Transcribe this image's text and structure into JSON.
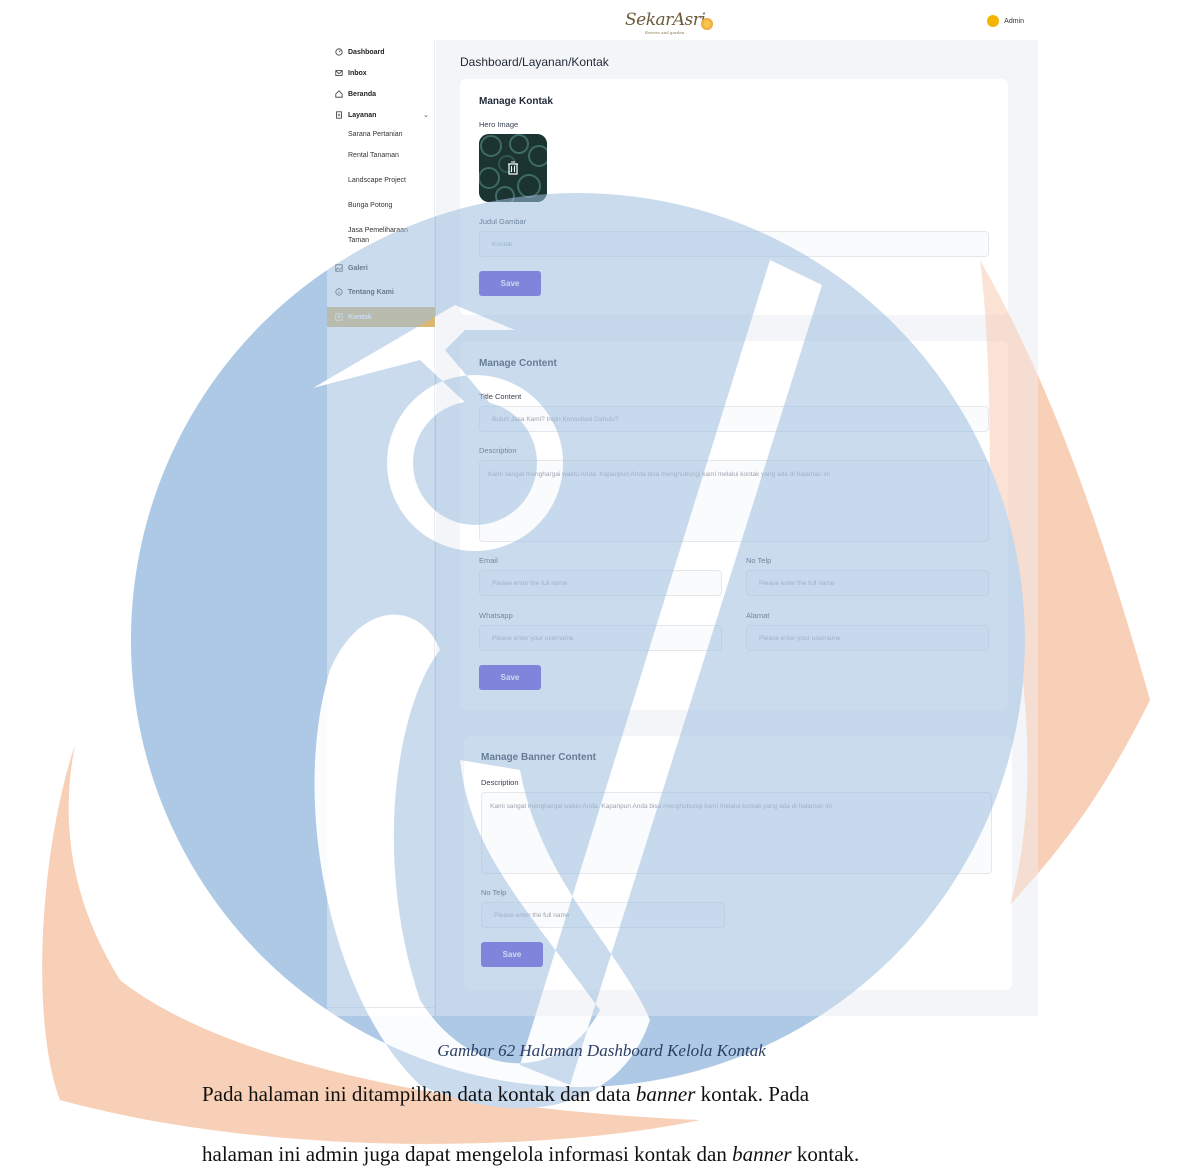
{
  "header": {
    "logo_text": "SekarAsri",
    "logo_tagline": "flowers and garden",
    "user_name": "Admin"
  },
  "sidebar": {
    "items": [
      {
        "label": "Dashboard",
        "icon": "dashboard-icon"
      },
      {
        "label": "Inbox",
        "icon": "mail-icon"
      },
      {
        "label": "Beranda",
        "icon": "home-icon"
      },
      {
        "label": "Layanan",
        "icon": "document-icon"
      },
      {
        "label": "Galeri",
        "icon": "image-icon"
      },
      {
        "label": "Tentang Kami",
        "icon": "info-icon"
      },
      {
        "label": "Kontak",
        "icon": "contact-icon"
      }
    ],
    "sub_items": [
      "Sarana Pertanian",
      "Rental Tanaman",
      "Landscape Project",
      "Bunga Potong",
      "Jasa Pemeliharaan Taman"
    ]
  },
  "breadcrumb": "Dashboard/Layanan/Kontak",
  "manage_kontak": {
    "title": "Manage Kontak",
    "hero_label": "Hero Image",
    "judul_label": "Judul Gambar",
    "judul_value": "Kontak",
    "save": "Save"
  },
  "manage_content": {
    "title": "Manage Content",
    "title_content_label": "Title Content",
    "title_content_value": "Butuh Jasa Kami? Ingin Konsultasi Dahulu?",
    "description_label": "Description",
    "description_value": "Kami sangat menghargai waktu Anda. Kapanpun Anda bisa menghubungi kami melalui kontak yang ada di halaman ini",
    "email_label": "Email",
    "email_placeholder": "Please enter the full name",
    "telp_label": "No Telp",
    "telp_placeholder": "Please enter the full name",
    "whatsapp_label": "Whatsapp",
    "whatsapp_placeholder": "Please enter your username",
    "alamat_label": "Alamat",
    "alamat_placeholder": "Please enter your username",
    "save": "Save"
  },
  "manage_banner": {
    "title": "Manage Banner Content",
    "description_label": "Description",
    "description_value": "Kami sangat menghargai waktu Anda. Kapanpun Anda bisa menghubungi kami melalui kontak yang ada di halaman ini",
    "telp_label": "No Telp",
    "telp_placeholder": "Please enter the full name",
    "save": "Save"
  },
  "document": {
    "caption": "Gambar 62 Halaman Dashboard Kelola Kontak",
    "para1_a": "Pada halaman ini ditampilkan data kontak dan data ",
    "para1_b": "banner",
    "para1_c": " kontak. Pada",
    "para2_a": "halaman ini admin juga dapat mengelola informasi kontak dan ",
    "para2_b": "banner",
    "para2_c": " kontak."
  },
  "colors": {
    "accent": "#5b3fd6",
    "active_nav": "#d9b872",
    "watermark_blue": "#bfd4ea",
    "watermark_orange": "#f6c9ad"
  }
}
